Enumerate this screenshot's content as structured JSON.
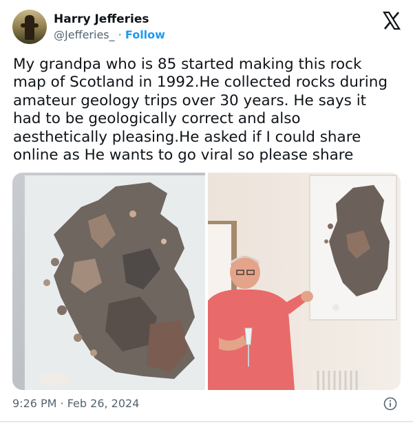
{
  "author": {
    "name": "Harry Jefferies",
    "handle": "@Jefferies_",
    "separator": "·",
    "follow_label": "Follow"
  },
  "tweet": {
    "text": "My grandpa who is 85 started making this rock\nmap of Scotland in 1992.He collected rocks during\namateur geology trips over 30 years. He says it\nhad to be geologically correct and also\naesthetically pleasing.He asked if I could share\nonline as He wants to go viral so please share",
    "timestamp": "9:26 PM · Feb 26, 2024"
  },
  "media": {
    "photos": [
      {
        "subject": "rock-map-closeup"
      },
      {
        "subject": "grandpa-with-map"
      }
    ]
  },
  "colors": {
    "accent": "#1d9bf0",
    "secondary_text": "#536471",
    "text": "#0f1419"
  },
  "icons": [
    "x-logo-icon",
    "info-icon"
  ]
}
